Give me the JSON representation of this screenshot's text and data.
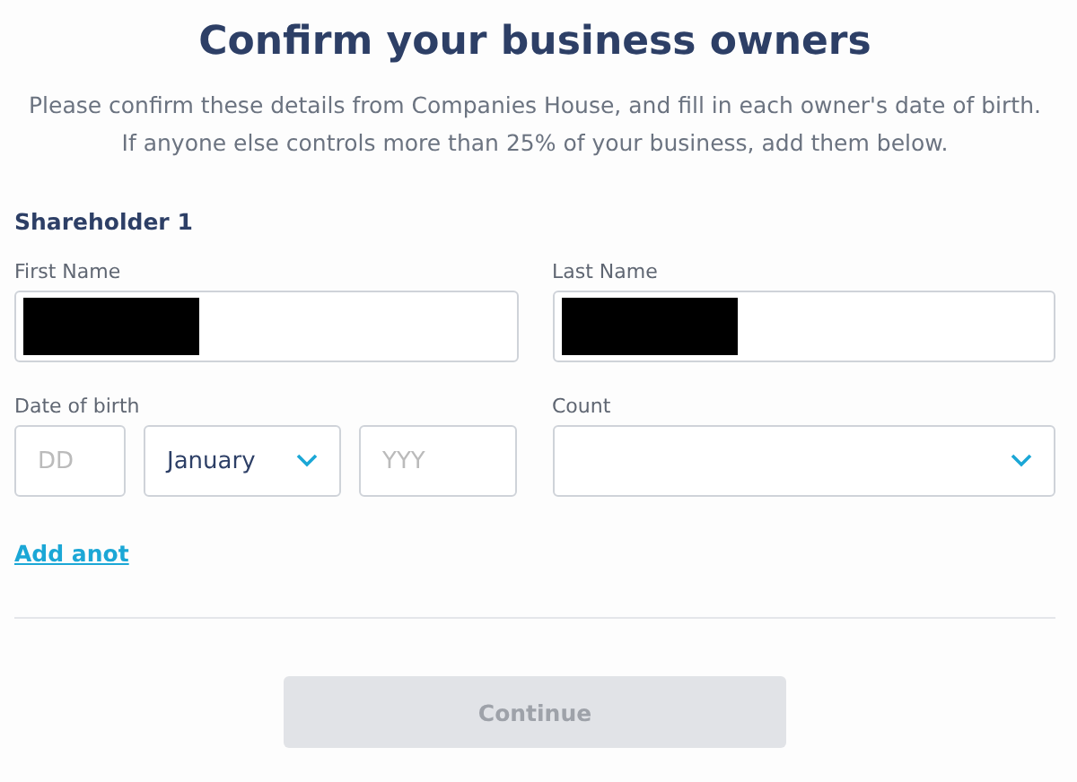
{
  "title": "Confirm your business owners",
  "intro": "Please confirm these details from Companies House, and fill in each owner's date of birth. If anyone else controls more than 25% of your business, add them below.",
  "shareholder": {
    "heading": "Shareholder 1",
    "first_name": {
      "label": "First Name",
      "redacted": true
    },
    "last_name": {
      "label": "Last Name",
      "redacted": true
    },
    "date_of_birth": {
      "label": "Date of birth",
      "day": {
        "placeholder": "DD"
      },
      "month": {
        "value": "January"
      },
      "year": {
        "placeholder": "YYY"
      }
    },
    "country": {
      "label": "Count"
    }
  },
  "add_link": "Add anot",
  "continue_button": {
    "label": "Continue",
    "disabled": true
  }
}
